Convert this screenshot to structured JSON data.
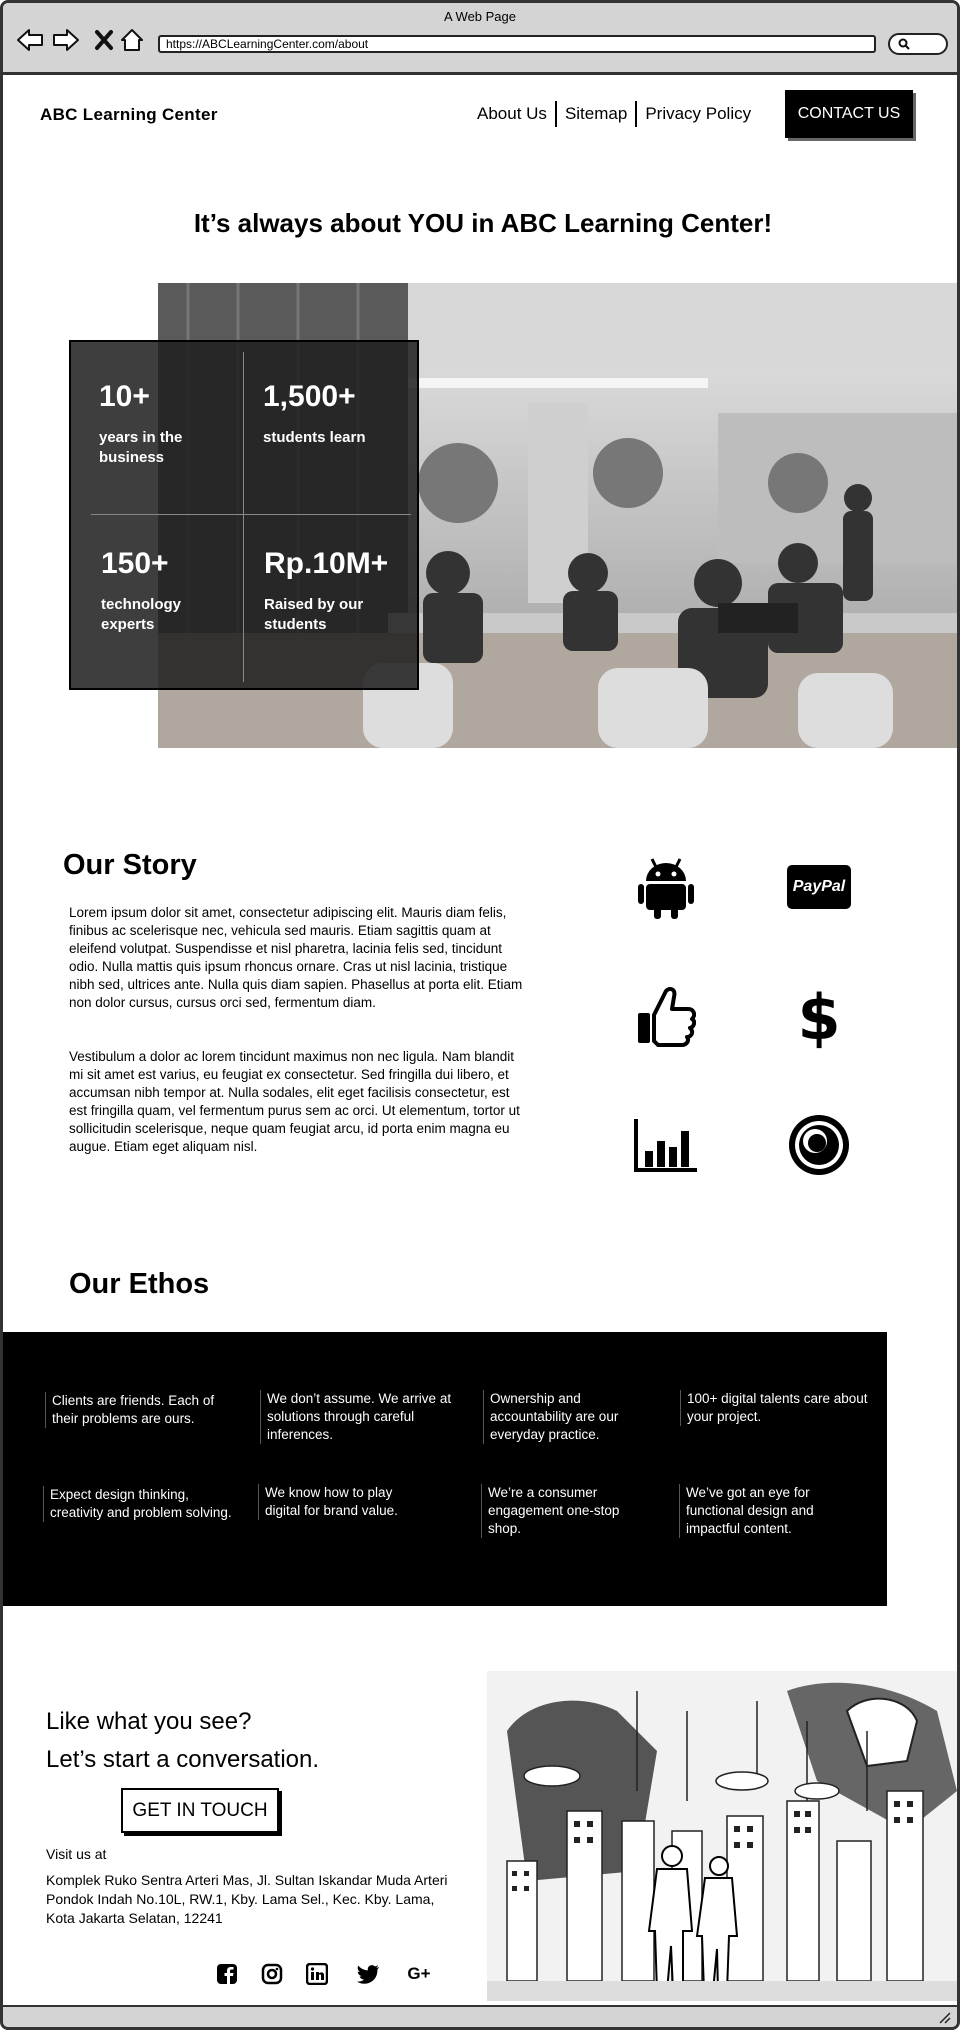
{
  "browser": {
    "window_title": "A Web Page",
    "url": "https://ABCLearningCenter.com/about"
  },
  "header": {
    "logo": "ABC Learning Center",
    "nav": [
      "About Us",
      "Sitemap",
      "Privacy Policy"
    ],
    "contact_button": "CONTACT US"
  },
  "hero": {
    "headline": "It’s always about YOU in ABC Learning Center!",
    "stats": [
      {
        "number": "10+",
        "label": "years in the business"
      },
      {
        "number": "1,500+",
        "label": "students learn"
      },
      {
        "number": "150+",
        "label": "technology experts"
      },
      {
        "number": "Rp.10M+",
        "label": "Raised by our students"
      }
    ]
  },
  "story": {
    "heading": "Our Story",
    "paragraphs": [
      "Lorem ipsum dolor sit amet, consectetur adipiscing elit. Mauris diam felis, finibus ac scelerisque nec, vehicula sed mauris. Etiam sagittis quam at eleifend volutpat. Suspendisse et nisl pharetra, lacinia felis sed, tincidunt odio. Nulla mattis quis ipsum rhoncus ornare. Cras ut nisl lacinia, tristique nibh sed, ultrices ante. Nulla quis diam sapien. Phasellus at porta elit. Etiam non dolor cursus, cursus orci sed, fermentum diam.",
      "Vestibulum a dolor ac lorem tincidunt maximus non nec ligula. Nam blandit mi sit amet est varius, eu feugiat ex consectetur. Sed fringilla dui libero, et accumsan nibh tempor at. Nulla sodales, elit eget facilisis consectetur, est est fringilla quam, vel fermentum purus sem ac orci. Ut elementum, tortor ut sollicitudin scelerisque, neque quam feugiat arcu, id porta enim magna eu augue. Etiam eget aliquam nisl."
    ],
    "icons": [
      "android-icon",
      "paypal-icon",
      "thumbs-up-icon",
      "dollar-icon",
      "bar-chart-icon",
      "target-icon"
    ],
    "paypal_text": "PayPal"
  },
  "ethos": {
    "heading": "Our Ethos",
    "items": [
      "Clients are friends. Each of their problems are ours.",
      "We don’t assume. We arrive at solutions through careful inferences.",
      "Ownership and accountability are our everyday practice.",
      "100+ digital talents care about your project.",
      "Expect design thinking, creativity and problem solving.",
      "We know how to play digital for brand value.",
      "We’re a consumer engagement one-stop shop.",
      "We’ve got an eye for functional design and impactful content."
    ]
  },
  "cta": {
    "line1": "Like what you see?",
    "line2": "Let’s start a conversation.",
    "button": "GET IN TOUCH",
    "visit_label": "Visit us at",
    "address": "Komplek Ruko Sentra Arteri Mas, Jl. Sultan Iskandar Muda Arteri Pondok Indah No.10L, RW.1, Kby. Lama Sel., Kec. Kby. Lama, Kota Jakarta Selatan, 12241",
    "socials": [
      "facebook-icon",
      "instagram-icon",
      "linkedin-icon",
      "twitter-icon",
      "google-plus-icon"
    ],
    "google_plus_text": "G+"
  }
}
